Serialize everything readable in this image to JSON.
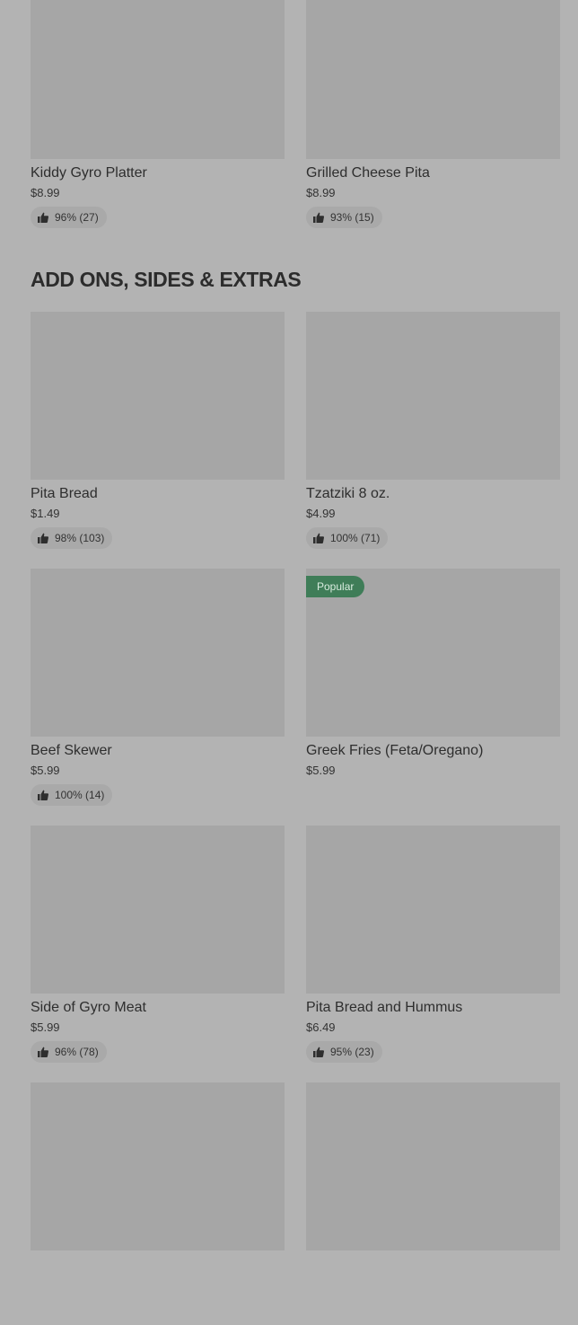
{
  "top_items": [
    {
      "name": "Kiddy Gyro Platter",
      "price": "$8.99",
      "rating": "96% (27)"
    },
    {
      "name": "Grilled Cheese Pita",
      "price": "$8.99",
      "rating": "93% (15)"
    }
  ],
  "section": {
    "title": "ADD ONS, SIDES & EXTRAS"
  },
  "items": [
    {
      "name": "Pita Bread",
      "price": "$1.49",
      "rating": "98% (103)"
    },
    {
      "name": "Tzatziki 8 oz.",
      "price": "$4.99",
      "rating": "100% (71)"
    },
    {
      "name": "Beef Skewer",
      "price": "$5.99",
      "rating": "100% (14)"
    },
    {
      "name": "Greek Fries (Feta/Oregano)",
      "price": "$5.99",
      "badge": "Popular"
    },
    {
      "name": "Side of Gyro Meat",
      "price": "$5.99",
      "rating": "96% (78)"
    },
    {
      "name": "Pita Bread and Hummus",
      "price": "$6.49",
      "rating": "95% (23)"
    }
  ],
  "colors": {
    "background": "#b3b3b3",
    "image_placeholder": "#a6a6a6",
    "badge": "#3f7d58"
  },
  "icons": {
    "rating": "thumbs-up-icon"
  }
}
